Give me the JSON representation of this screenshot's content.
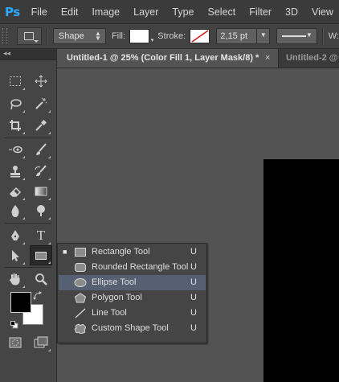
{
  "menubar": {
    "logo": "Ps",
    "items": [
      "File",
      "Edit",
      "Image",
      "Layer",
      "Type",
      "Select",
      "Filter",
      "3D",
      "View"
    ]
  },
  "options_bar": {
    "mode": "Shape",
    "fill_label": "Fill:",
    "stroke_label": "Stroke:",
    "stroke_width": "2,15 pt",
    "width_label": "W:"
  },
  "tabs": {
    "active": "Untitled-1 @ 25% (Color Fill 1, Layer Mask/8) *",
    "close": "×",
    "inactive": "Untitled-2 @"
  },
  "toolbox": {
    "collapse": "◂◂",
    "foreground_color": "#000000",
    "background_color": "#ffffff"
  },
  "flyout": {
    "items": [
      {
        "label": "Rectangle Tool",
        "key": "U",
        "icon": "rectangle-icon",
        "selected": true
      },
      {
        "label": "Rounded Rectangle Tool",
        "key": "U",
        "icon": "rounded-rectangle-icon",
        "selected": false
      },
      {
        "label": "Ellipse Tool",
        "key": "U",
        "icon": "ellipse-icon",
        "selected": false
      },
      {
        "label": "Polygon Tool",
        "key": "U",
        "icon": "polygon-icon",
        "selected": false
      },
      {
        "label": "Line Tool",
        "key": "U",
        "icon": "line-icon",
        "selected": false
      },
      {
        "label": "Custom Shape Tool",
        "key": "U",
        "icon": "custom-shape-icon",
        "selected": false
      }
    ],
    "highlight_color": "#556073"
  },
  "colors": {
    "accent": "#2ea8ff",
    "document": "#000000"
  }
}
